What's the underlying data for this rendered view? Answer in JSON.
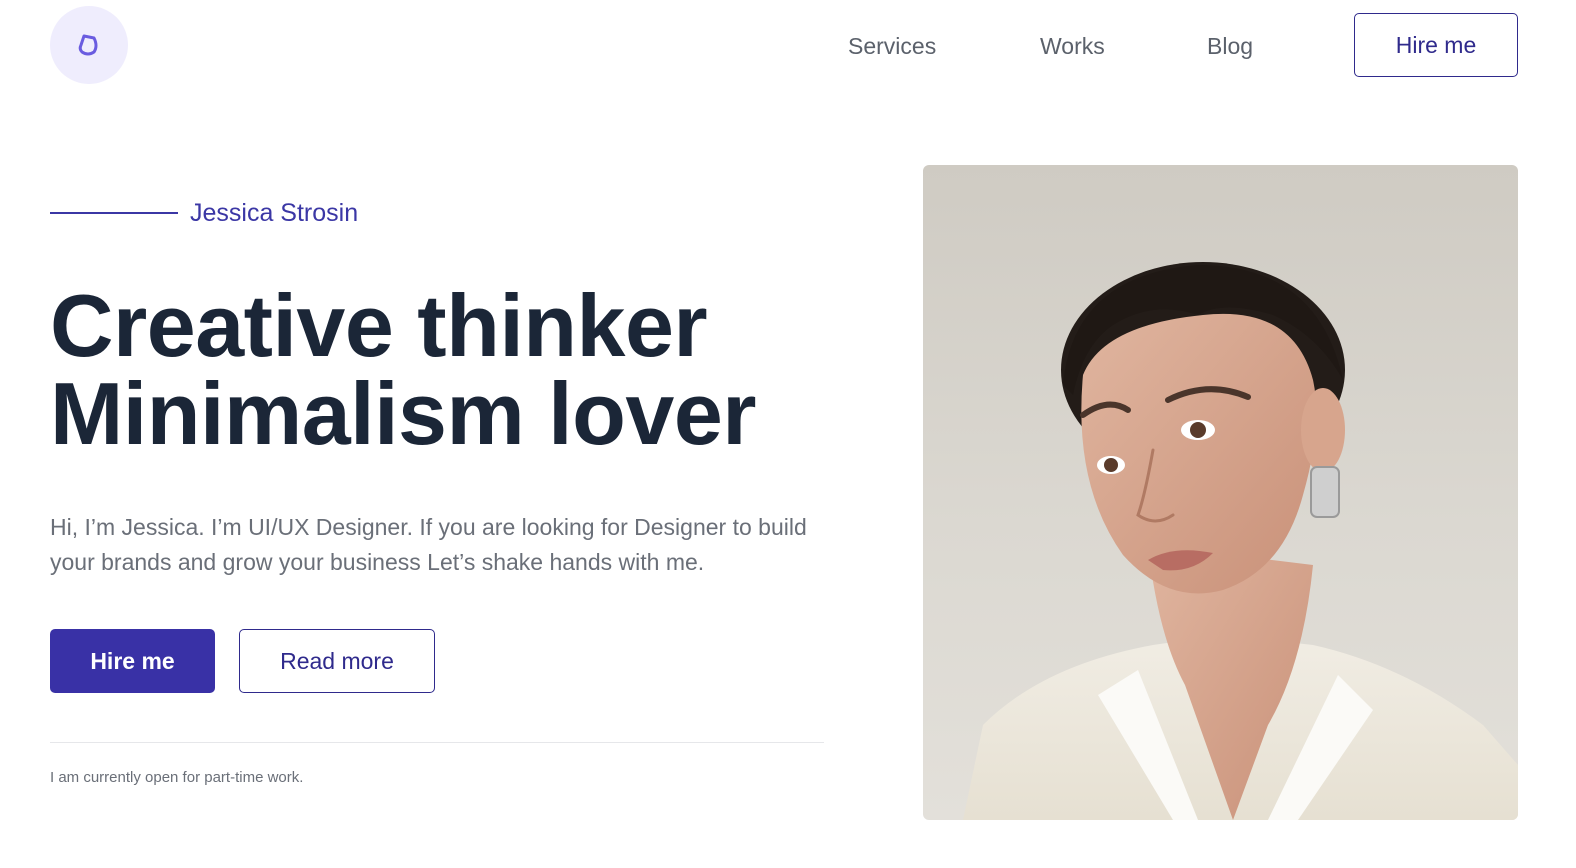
{
  "header": {
    "logo_icon": "droplet-logo-icon",
    "nav": [
      {
        "label": "Services"
      },
      {
        "label": "Works"
      },
      {
        "label": "Blog"
      }
    ],
    "hire_label": "Hire me"
  },
  "hero": {
    "name": "Jessica Strosin",
    "headline_line1": "Creative thinker",
    "headline_line2": "Minimalism lover",
    "intro": "Hi, I’m Jessica. I’m UI/UX Designer. If you are looking for Designer to build your brands and grow your business Let’s shake hands with me.",
    "primary_button": "Hire me",
    "secondary_button": "Read more",
    "availability": "I am currently open for part-time work."
  },
  "colors": {
    "accent": "#3931a6",
    "heading": "#1b2637",
    "body_text": "#6a6f78",
    "logo_bg": "#efedfd"
  }
}
